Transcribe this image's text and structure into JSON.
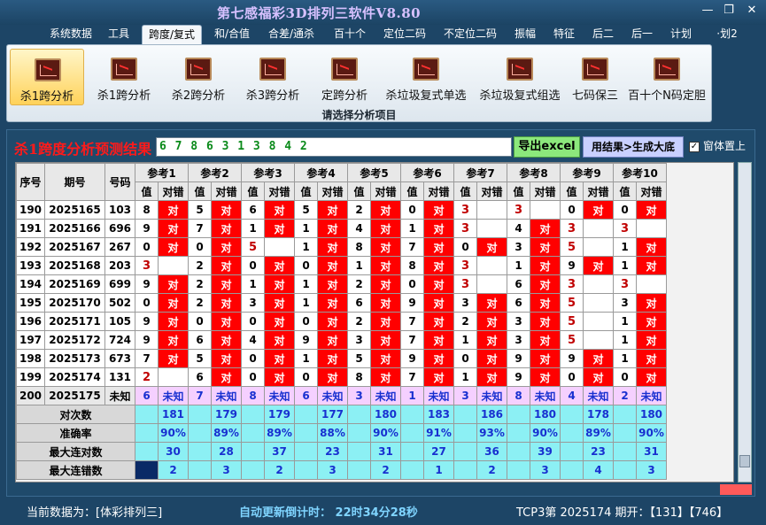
{
  "app_title": "第七感福彩3D排列三软件V8.80",
  "window_buttons": [
    "—",
    "❐",
    "✕"
  ],
  "menu": [
    "系统数据",
    "工具",
    "跨度/复式",
    "和/合值",
    "合差/通杀",
    "百十个",
    "定位二码",
    "不定位二码",
    "振幅",
    "特征",
    "后二",
    "后一",
    "计划",
    "·划2"
  ],
  "ribbon": {
    "buttons": [
      "杀1跨分析",
      "杀1跨分析",
      "杀2跨分析",
      "杀3跨分析",
      "定跨分析",
      "杀垃圾复式单选",
      "杀垃圾复式组选",
      "七码保三",
      "百十个N码定胆"
    ],
    "caption": "请选择分析项目"
  },
  "heading": "杀1跨度分析预测结果",
  "result": "6 7 8 6 3 1 3 8 4 2",
  "export_label": "导出excel",
  "generate_label": "用结果>生成大底",
  "topmost_label": "窗体置上",
  "table": {
    "h_seq": "序号",
    "h_issue": "期号",
    "h_code": "号码",
    "refs": [
      "参考1",
      "参考2",
      "参考3",
      "参考4",
      "参考5",
      "参考6",
      "参考7",
      "参考8",
      "参考9",
      "参考10"
    ],
    "sub": [
      "值",
      "对错"
    ],
    "rows": [
      [
        "190",
        "2025165",
        "103",
        "8",
        "对",
        "5",
        "对",
        "6",
        "对",
        "5",
        "对",
        "2",
        "对",
        "0",
        "对",
        "3",
        "",
        "3",
        "",
        "0",
        "对",
        "0",
        "对"
      ],
      [
        "191",
        "2025166",
        "696",
        "9",
        "对",
        "7",
        "对",
        "1",
        "对",
        "1",
        "对",
        "4",
        "对",
        "1",
        "对",
        "3",
        "",
        "4",
        "对",
        "3",
        "",
        "3",
        ""
      ],
      [
        "192",
        "2025167",
        "267",
        "0",
        "对",
        "0",
        "对",
        "5",
        "",
        "1",
        "对",
        "8",
        "对",
        "7",
        "对",
        "0",
        "对",
        "3",
        "对",
        "5",
        "",
        "1",
        "对"
      ],
      [
        "193",
        "2025168",
        "203",
        "3",
        "",
        "2",
        "对",
        "0",
        "对",
        "0",
        "对",
        "1",
        "对",
        "8",
        "对",
        "3",
        "",
        "1",
        "对",
        "9",
        "对",
        "1",
        "对"
      ],
      [
        "194",
        "2025169",
        "699",
        "9",
        "对",
        "2",
        "对",
        "1",
        "对",
        "1",
        "对",
        "2",
        "对",
        "0",
        "对",
        "3",
        "",
        "6",
        "对",
        "3",
        "",
        "3",
        ""
      ],
      [
        "195",
        "2025170",
        "502",
        "0",
        "对",
        "2",
        "对",
        "3",
        "对",
        "1",
        "对",
        "6",
        "对",
        "9",
        "对",
        "3",
        "对",
        "6",
        "对",
        "5",
        "",
        "3",
        "对"
      ],
      [
        "196",
        "2025171",
        "105",
        "9",
        "对",
        "0",
        "对",
        "0",
        "对",
        "0",
        "对",
        "2",
        "对",
        "7",
        "对",
        "2",
        "对",
        "3",
        "对",
        "5",
        "",
        "1",
        "对"
      ],
      [
        "197",
        "2025172",
        "724",
        "9",
        "对",
        "6",
        "对",
        "4",
        "对",
        "9",
        "对",
        "3",
        "对",
        "7",
        "对",
        "1",
        "对",
        "3",
        "对",
        "5",
        "",
        "1",
        "对"
      ],
      [
        "198",
        "2025173",
        "673",
        "7",
        "对",
        "5",
        "对",
        "0",
        "对",
        "1",
        "对",
        "5",
        "对",
        "9",
        "对",
        "0",
        "对",
        "9",
        "对",
        "9",
        "对",
        "1",
        "对"
      ],
      [
        "199",
        "2025174",
        "131",
        "2",
        "",
        "6",
        "对",
        "0",
        "对",
        "0",
        "对",
        "8",
        "对",
        "7",
        "对",
        "1",
        "对",
        "9",
        "对",
        "0",
        "对",
        "0",
        "对"
      ]
    ],
    "unknown": [
      "200",
      "2025175",
      "未知",
      "6",
      "未知",
      "7",
      "未知",
      "8",
      "未知",
      "6",
      "未知",
      "3",
      "未知",
      "1",
      "未知",
      "3",
      "未知",
      "8",
      "未知",
      "4",
      "未知",
      "2",
      "未知"
    ],
    "stats": [
      {
        "label": "对次数",
        "values": [
          "181",
          "179",
          "179",
          "177",
          "180",
          "183",
          "186",
          "180",
          "178",
          "180"
        ]
      },
      {
        "label": "准确率",
        "values": [
          "90%",
          "89%",
          "89%",
          "88%",
          "90%",
          "91%",
          "93%",
          "90%",
          "89%",
          "90%"
        ]
      },
      {
        "label": "最大连对数",
        "values": [
          "30",
          "28",
          "37",
          "23",
          "31",
          "27",
          "36",
          "39",
          "23",
          "31"
        ]
      },
      {
        "label": "最大连错数",
        "values": [
          "2",
          "3",
          "2",
          "3",
          "2",
          "1",
          "2",
          "3",
          "4",
          "3"
        ]
      }
    ]
  },
  "status": {
    "source": "当前数据为：[体彩排列三]",
    "countdown": "自动更新倒计时：  22时34分28秒",
    "issue": "TCP3第 2025174 期开：【131】【746】"
  }
}
